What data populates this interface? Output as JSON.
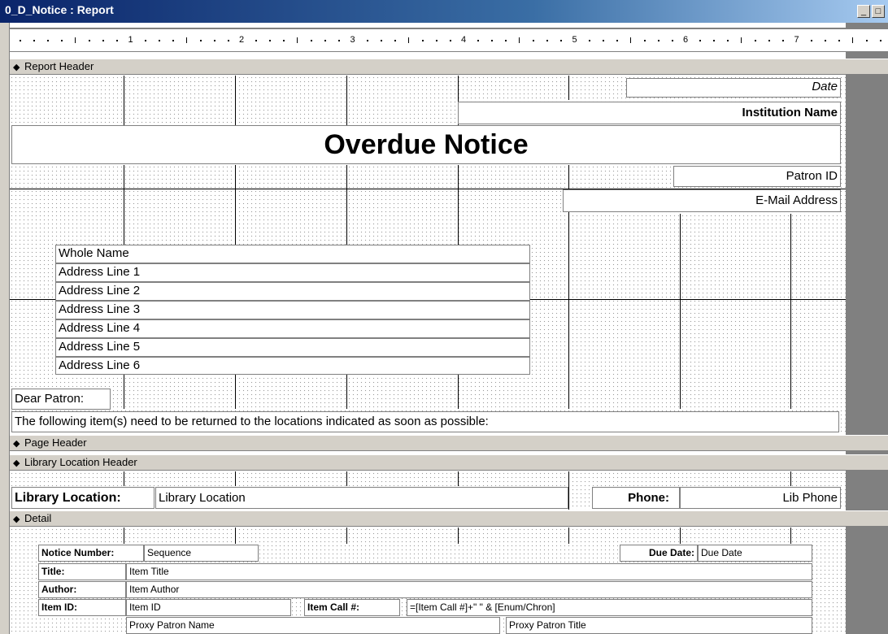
{
  "window": {
    "title": "0_D_Notice : Report",
    "minimize_label": "_",
    "maximize_label": "□"
  },
  "ruler": {
    "numbers": [
      "1",
      "2",
      "3",
      "4",
      "5",
      "6",
      "7"
    ]
  },
  "sections": {
    "report_header": "Report Header",
    "page_header": "Page Header",
    "library_location_header": "Library Location Header",
    "detail": "Detail"
  },
  "section_marker": "◆",
  "report_header": {
    "date": "Date",
    "institution_name": "Institution Name",
    "title": "Overdue Notice",
    "patron_id": "Patron ID",
    "email_address": "E-Mail Address",
    "whole_name": "Whole Name",
    "address_lines": [
      "Address Line 1",
      "Address Line 2",
      "Address Line 3",
      "Address Line 4",
      "Address Line 5",
      "Address Line 6"
    ],
    "greeting": "Dear Patron:",
    "message": "The following item(s) need to be returned to the locations indicated as soon as possible:"
  },
  "location_header": {
    "library_location_label": "Library Location:",
    "library_location_value": "Library Location",
    "phone_label": "Phone:",
    "phone_value": "Lib Phone"
  },
  "detail": {
    "notice_number_label": "Notice Number:",
    "notice_number_value": "Sequence",
    "due_date_label": "Due Date:",
    "due_date_value": "Due Date",
    "title_label": "Title:",
    "title_value": "Item Title",
    "author_label": "Author:",
    "author_value": "Item Author",
    "item_id_label": "Item ID:",
    "item_id_value": "Item ID",
    "call_label": "Item Call #:",
    "call_value": "=[Item Call #]+\"  \" & [Enum/Chron]",
    "proxy_name": "Proxy Patron Name",
    "proxy_title": "Proxy Patron Title"
  }
}
